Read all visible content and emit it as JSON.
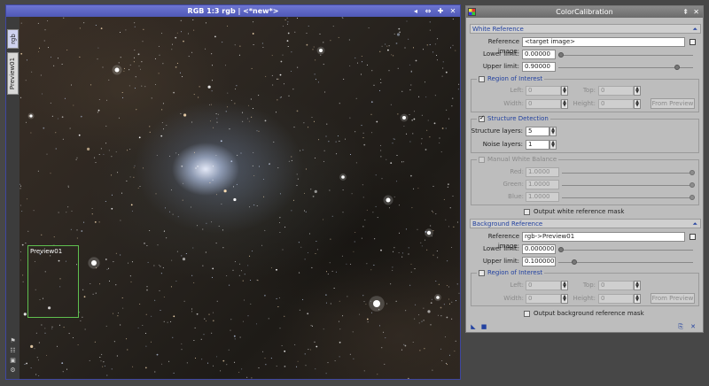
{
  "image_window": {
    "title": "RGB 1:3 rgb | <*new*>",
    "tabs": [
      "rgb",
      "Preview01"
    ],
    "preview_label": "Preview01",
    "title_buttons": [
      "◂",
      "⇔",
      "✚",
      "✕"
    ],
    "side_icons": [
      "flag-icon",
      "sliders-icon",
      "lock-icon",
      "gear-icon"
    ]
  },
  "process": {
    "title": "ColorCalibration",
    "white_reference": {
      "heading": "White Reference",
      "reference_image_label": "Reference image:",
      "reference_image_value": "<target image>",
      "lower_limit_label": "Lower limit:",
      "lower_limit_value": "0.00000",
      "lower_limit_fraction": 0.0,
      "upper_limit_label": "Upper limit:",
      "upper_limit_value": "0.90000",
      "upper_limit_fraction": 0.9,
      "roi": {
        "label": "Region of Interest",
        "checked": false,
        "left_label": "Left:",
        "left_value": "0",
        "top_label": "Top:",
        "top_value": "0",
        "width_label": "Width:",
        "width_value": "0",
        "height_label": "Height:",
        "height_value": "0",
        "from_preview": "From Preview"
      },
      "structure": {
        "label": "Structure Detection",
        "checked": true,
        "structure_layers_label": "Structure layers:",
        "structure_layers_value": "5",
        "noise_layers_label": "Noise layers:",
        "noise_layers_value": "1"
      },
      "manual_wb": {
        "label": "Manual White Balance",
        "checked": false,
        "red_label": "Red:",
        "red_value": "1.0000",
        "green_label": "Green:",
        "green_value": "1.0000",
        "blue_label": "Blue:",
        "blue_value": "1.0000"
      },
      "output_mask_label": "Output white reference mask"
    },
    "background_reference": {
      "heading": "Background Reference",
      "reference_image_label": "Reference image:",
      "reference_image_value": "rgb->Preview01",
      "lower_limit_label": "Lower limit:",
      "lower_limit_value": "0.000000",
      "lower_limit_fraction": 0.0,
      "upper_limit_label": "Upper limit:",
      "upper_limit_value": "0.100000",
      "upper_limit_fraction": 0.1,
      "roi": {
        "label": "Region of Interest",
        "checked": false,
        "left_label": "Left:",
        "left_value": "0",
        "top_label": "Top:",
        "top_value": "0",
        "width_label": "Width:",
        "width_value": "0",
        "height_label": "Height:",
        "height_value": "0",
        "from_preview": "From Preview"
      },
      "output_mask_label": "Output background reference mask"
    }
  },
  "colors": {
    "window_title": "#5c65c0",
    "section_heading": "#2342a0",
    "preview_rect": "#5fbf4f"
  }
}
